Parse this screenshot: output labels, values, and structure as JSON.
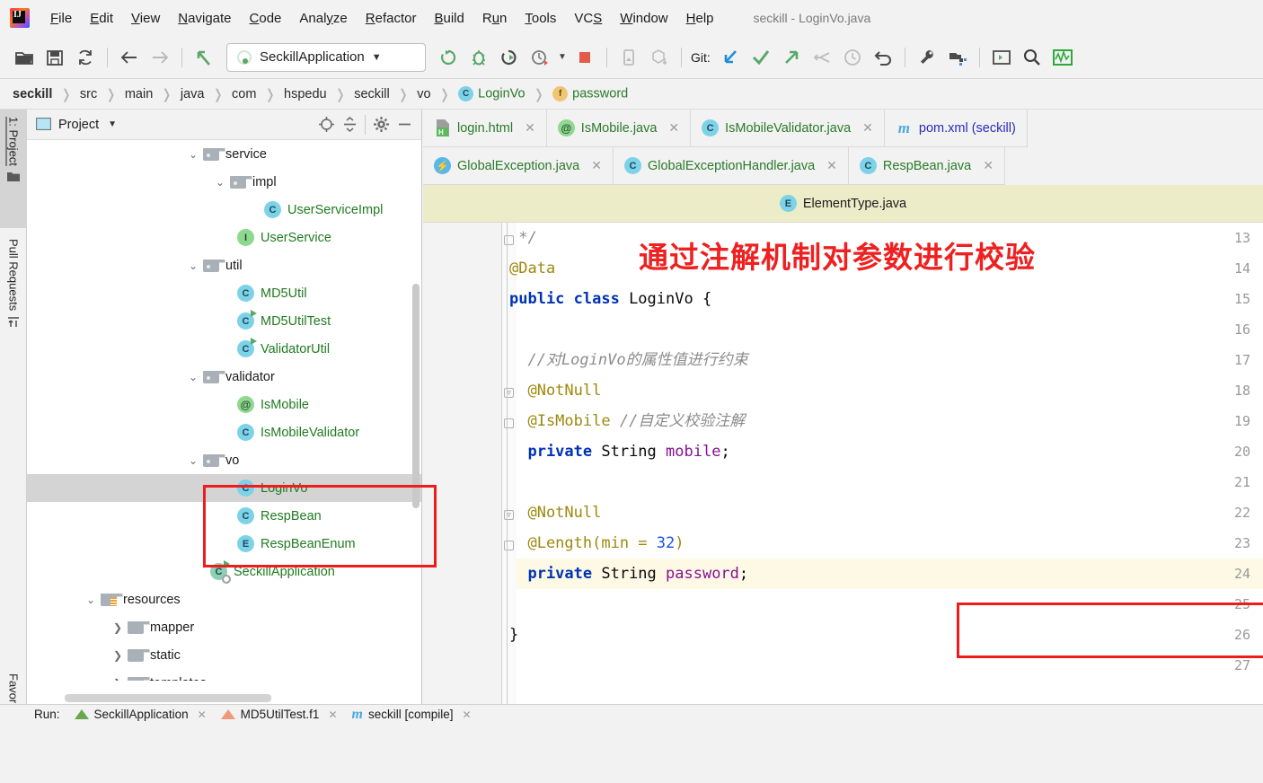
{
  "window": {
    "title": "seckill - LoginVo.java"
  },
  "menu": {
    "items": [
      {
        "label": "File",
        "mnemonic": "F"
      },
      {
        "label": "Edit",
        "mnemonic": "E"
      },
      {
        "label": "View",
        "mnemonic": "V"
      },
      {
        "label": "Navigate",
        "mnemonic": "N"
      },
      {
        "label": "Code",
        "mnemonic": "C"
      },
      {
        "label": "Analyze",
        "mnemonic": "y"
      },
      {
        "label": "Refactor",
        "mnemonic": "R"
      },
      {
        "label": "Build",
        "mnemonic": "B"
      },
      {
        "label": "Run",
        "mnemonic": "u"
      },
      {
        "label": "Tools",
        "mnemonic": "T"
      },
      {
        "label": "VCS",
        "mnemonic": "S"
      },
      {
        "label": "Window",
        "mnemonic": "W"
      },
      {
        "label": "Help",
        "mnemonic": "H"
      }
    ]
  },
  "toolbar": {
    "run_config": "SeckillApplication",
    "git_label": "Git:",
    "icons": [
      "open-project-icon",
      "save-all-icon",
      "sync-icon",
      "back-icon",
      "forward-icon",
      "pop-up-icon",
      "run-icon",
      "debug-icon",
      "run-with-coverage-icon",
      "profiler-icon",
      "stop-icon",
      "device-manager-icon",
      "sdk-manager-icon",
      "git-update-icon",
      "git-commit-icon",
      "git-push-icon",
      "git-rebase-icon",
      "git-history-icon",
      "git-rollback-icon",
      "settings-wrench-icon",
      "project-structure-icon",
      "terminal-icon",
      "search-everywhere-icon",
      "monitor-icon"
    ]
  },
  "breadcrumb": {
    "items": [
      {
        "label": "seckill",
        "kind": "project"
      },
      {
        "label": "src",
        "kind": "folder"
      },
      {
        "label": "main",
        "kind": "folder"
      },
      {
        "label": "java",
        "kind": "folder"
      },
      {
        "label": "com",
        "kind": "folder"
      },
      {
        "label": "hspedu",
        "kind": "folder"
      },
      {
        "label": "seckill",
        "kind": "folder"
      },
      {
        "label": "vo",
        "kind": "folder"
      },
      {
        "label": "LoginVo",
        "kind": "class",
        "badge": "C"
      },
      {
        "label": "password",
        "kind": "field",
        "badge": "f"
      }
    ]
  },
  "left_strip": {
    "tabs": [
      {
        "label": "1: Project",
        "active": true,
        "icon": "project-folder-icon"
      },
      {
        "label": "Pull Requests",
        "active": false,
        "icon": "pull-request-icon"
      },
      {
        "label": "Favorites",
        "active": false,
        "icon": ""
      }
    ]
  },
  "project_panel": {
    "title": "Project",
    "header_buttons": [
      "locate-target-icon",
      "collapse-all-icon",
      "settings-gear-icon",
      "hide-icon"
    ],
    "tree": [
      {
        "label": "service",
        "indent": 4,
        "chevron": "down",
        "icon": "folder",
        "green": false
      },
      {
        "label": "impl",
        "indent": 5,
        "chevron": "down",
        "icon": "folder",
        "green": false
      },
      {
        "label": "UserServiceImpl",
        "indent": 7,
        "chevron": "",
        "icon": "class",
        "green": true
      },
      {
        "label": "UserService",
        "indent": 6,
        "chevron": "",
        "icon": "interface",
        "green": true
      },
      {
        "label": "util",
        "indent": 4,
        "chevron": "down",
        "icon": "folder",
        "green": false
      },
      {
        "label": "MD5Util",
        "indent": 6,
        "chevron": "",
        "icon": "class",
        "green": true
      },
      {
        "label": "MD5UtilTest",
        "indent": 6,
        "chevron": "",
        "icon": "class-run",
        "green": true
      },
      {
        "label": "ValidatorUtil",
        "indent": 6,
        "chevron": "",
        "icon": "class-run",
        "green": true
      },
      {
        "label": "validator",
        "indent": 4,
        "chevron": "down",
        "icon": "folder",
        "green": false
      },
      {
        "label": "IsMobile",
        "indent": 6,
        "chevron": "",
        "icon": "annotation",
        "green": true
      },
      {
        "label": "IsMobileValidator",
        "indent": 6,
        "chevron": "",
        "icon": "class",
        "green": true
      },
      {
        "label": "vo",
        "indent": 4,
        "chevron": "down",
        "icon": "folder",
        "green": false
      },
      {
        "label": "LoginVo",
        "indent": 6,
        "chevron": "",
        "icon": "class",
        "green": true,
        "selected": true
      },
      {
        "label": "RespBean",
        "indent": 6,
        "chevron": "",
        "icon": "class",
        "green": true
      },
      {
        "label": "RespBeanEnum",
        "indent": 6,
        "chevron": "",
        "icon": "enum",
        "green": true
      },
      {
        "label": "SeckillApplication",
        "indent": 5,
        "chevron": "",
        "icon": "spring-app",
        "green": true
      },
      {
        "label": "resources",
        "indent": 2,
        "chevron": "down",
        "icon": "resources",
        "green": false
      },
      {
        "label": "mapper",
        "indent": 3,
        "chevron": "right",
        "icon": "folder-plain",
        "green": false
      },
      {
        "label": "static",
        "indent": 3,
        "chevron": "right",
        "icon": "folder-plain",
        "green": false
      },
      {
        "label": "templates",
        "indent": 3,
        "chevron": "right",
        "icon": "folder-plain",
        "green": false
      }
    ],
    "highlight_note": "red box around validator package"
  },
  "editor_tabs": {
    "row1": [
      {
        "label": "login.html",
        "icon": "html-file-icon",
        "color": "green",
        "closable": true
      },
      {
        "label": "IsMobile.java",
        "icon": "annotation-icon",
        "color": "green",
        "closable": true
      },
      {
        "label": "IsMobileValidator.java",
        "icon": "class-icon",
        "color": "green",
        "closable": true
      },
      {
        "label": "pom.xml (seckill)",
        "icon": "maven-icon",
        "color": "blue",
        "closable": false
      }
    ],
    "row2": [
      {
        "label": "GlobalException.java",
        "icon": "exception-icon",
        "color": "green",
        "closable": true
      },
      {
        "label": "GlobalExceptionHandler.java",
        "icon": "class-icon",
        "color": "green",
        "closable": true
      },
      {
        "label": "RespBean.java",
        "icon": "class-icon",
        "color": "green",
        "closable": true
      }
    ],
    "row3": [
      {
        "label": "ElementType.java",
        "icon": "enum-icon",
        "color": "dark",
        "active": true
      }
    ]
  },
  "code": {
    "file": "LoginVo.java",
    "annotation_note": "通过注解机制对参数进行校验",
    "current_line": 24,
    "lines": [
      {
        "n": 13,
        "tokens": [
          {
            "t": " */",
            "c": "cmt"
          }
        ],
        "fold": "end"
      },
      {
        "n": 14,
        "tokens": [
          {
            "t": "@Data",
            "c": "ann"
          }
        ]
      },
      {
        "n": 15,
        "tokens": [
          {
            "t": "public ",
            "c": "kw"
          },
          {
            "t": "class ",
            "c": "kw"
          },
          {
            "t": "LoginVo {",
            "c": "pln"
          }
        ]
      },
      {
        "n": 16,
        "tokens": []
      },
      {
        "n": 17,
        "tokens": [
          {
            "t": "    //对LoginVo的属性值进行约束",
            "c": "cmt"
          }
        ]
      },
      {
        "n": 18,
        "tokens": [
          {
            "t": "    @NotNull",
            "c": "ann"
          }
        ],
        "fold": "start"
      },
      {
        "n": 19,
        "tokens": [
          {
            "t": "    @IsMobile ",
            "c": "ann"
          },
          {
            "t": "//自定义校验注解",
            "c": "cmt"
          }
        ],
        "fold": "end"
      },
      {
        "n": 20,
        "tokens": [
          {
            "t": "    private ",
            "c": "kw"
          },
          {
            "t": "String ",
            "c": "pln"
          },
          {
            "t": "mobile",
            "c": "fld"
          },
          {
            "t": ";",
            "c": "pln"
          }
        ]
      },
      {
        "n": 21,
        "tokens": []
      },
      {
        "n": 22,
        "tokens": [
          {
            "t": "    @NotNull",
            "c": "ann"
          }
        ],
        "fold": "start"
      },
      {
        "n": 23,
        "tokens": [
          {
            "t": "    @Length(min = ",
            "c": "ann"
          },
          {
            "t": "32",
            "c": "num"
          },
          {
            "t": ")",
            "c": "ann"
          }
        ],
        "fold": "end"
      },
      {
        "n": 24,
        "tokens": [
          {
            "t": "    private ",
            "c": "kw"
          },
          {
            "t": "String ",
            "c": "pln"
          },
          {
            "t": "password",
            "c": "fld"
          },
          {
            "t": ";",
            "c": "pln"
          }
        ]
      },
      {
        "n": 25,
        "tokens": []
      },
      {
        "n": 26,
        "tokens": [
          {
            "t": "}",
            "c": "pln"
          }
        ]
      },
      {
        "n": 27,
        "tokens": []
      }
    ],
    "highlight_note": "red box around @NotNull / @IsMobile lines 18-19"
  },
  "bottom_bar": {
    "run_label": "Run:",
    "items": [
      {
        "label": "SeckillApplication",
        "icon": "run-config-icon"
      },
      {
        "label": "MD5UtilTest.f1",
        "icon": "test-config-icon"
      },
      {
        "label": "seckill [compile]",
        "icon": "maven-icon"
      }
    ]
  },
  "colors": {
    "accent_red": "#ee1c1c",
    "tab_active_bg": "#edecc8",
    "selection_bg": "#d4d4d4",
    "green_text": "#207b20",
    "blue_keyword": "#0033b3",
    "annotation_gold": "#9e880d",
    "field_purple": "#871094",
    "current_line_bg": "#fdf9e5"
  }
}
